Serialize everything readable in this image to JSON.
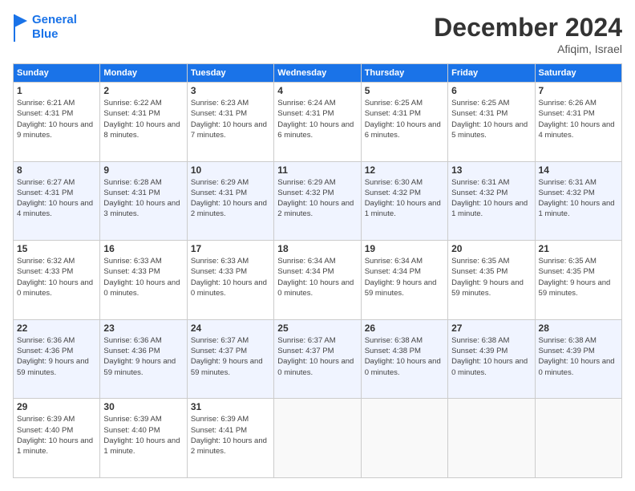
{
  "header": {
    "logo_line1": "General",
    "logo_line2": "Blue",
    "month_title": "December 2024",
    "subtitle": "Afiqim, Israel"
  },
  "days_of_week": [
    "Sunday",
    "Monday",
    "Tuesday",
    "Wednesday",
    "Thursday",
    "Friday",
    "Saturday"
  ],
  "weeks": [
    [
      {
        "day": 1,
        "sunrise": "6:21 AM",
        "sunset": "4:31 PM",
        "daylight": "10 hours and 9 minutes."
      },
      {
        "day": 2,
        "sunrise": "6:22 AM",
        "sunset": "4:31 PM",
        "daylight": "10 hours and 8 minutes."
      },
      {
        "day": 3,
        "sunrise": "6:23 AM",
        "sunset": "4:31 PM",
        "daylight": "10 hours and 7 minutes."
      },
      {
        "day": 4,
        "sunrise": "6:24 AM",
        "sunset": "4:31 PM",
        "daylight": "10 hours and 6 minutes."
      },
      {
        "day": 5,
        "sunrise": "6:25 AM",
        "sunset": "4:31 PM",
        "daylight": "10 hours and 6 minutes."
      },
      {
        "day": 6,
        "sunrise": "6:25 AM",
        "sunset": "4:31 PM",
        "daylight": "10 hours and 5 minutes."
      },
      {
        "day": 7,
        "sunrise": "6:26 AM",
        "sunset": "4:31 PM",
        "daylight": "10 hours and 4 minutes."
      }
    ],
    [
      {
        "day": 8,
        "sunrise": "6:27 AM",
        "sunset": "4:31 PM",
        "daylight": "10 hours and 4 minutes."
      },
      {
        "day": 9,
        "sunrise": "6:28 AM",
        "sunset": "4:31 PM",
        "daylight": "10 hours and 3 minutes."
      },
      {
        "day": 10,
        "sunrise": "6:29 AM",
        "sunset": "4:31 PM",
        "daylight": "10 hours and 2 minutes."
      },
      {
        "day": 11,
        "sunrise": "6:29 AM",
        "sunset": "4:32 PM",
        "daylight": "10 hours and 2 minutes."
      },
      {
        "day": 12,
        "sunrise": "6:30 AM",
        "sunset": "4:32 PM",
        "daylight": "10 hours and 1 minute."
      },
      {
        "day": 13,
        "sunrise": "6:31 AM",
        "sunset": "4:32 PM",
        "daylight": "10 hours and 1 minute."
      },
      {
        "day": 14,
        "sunrise": "6:31 AM",
        "sunset": "4:32 PM",
        "daylight": "10 hours and 1 minute."
      }
    ],
    [
      {
        "day": 15,
        "sunrise": "6:32 AM",
        "sunset": "4:33 PM",
        "daylight": "10 hours and 0 minutes."
      },
      {
        "day": 16,
        "sunrise": "6:33 AM",
        "sunset": "4:33 PM",
        "daylight": "10 hours and 0 minutes."
      },
      {
        "day": 17,
        "sunrise": "6:33 AM",
        "sunset": "4:33 PM",
        "daylight": "10 hours and 0 minutes."
      },
      {
        "day": 18,
        "sunrise": "6:34 AM",
        "sunset": "4:34 PM",
        "daylight": "10 hours and 0 minutes."
      },
      {
        "day": 19,
        "sunrise": "6:34 AM",
        "sunset": "4:34 PM",
        "daylight": "9 hours and 59 minutes."
      },
      {
        "day": 20,
        "sunrise": "6:35 AM",
        "sunset": "4:35 PM",
        "daylight": "9 hours and 59 minutes."
      },
      {
        "day": 21,
        "sunrise": "6:35 AM",
        "sunset": "4:35 PM",
        "daylight": "9 hours and 59 minutes."
      }
    ],
    [
      {
        "day": 22,
        "sunrise": "6:36 AM",
        "sunset": "4:36 PM",
        "daylight": "9 hours and 59 minutes."
      },
      {
        "day": 23,
        "sunrise": "6:36 AM",
        "sunset": "4:36 PM",
        "daylight": "9 hours and 59 minutes."
      },
      {
        "day": 24,
        "sunrise": "6:37 AM",
        "sunset": "4:37 PM",
        "daylight": "9 hours and 59 minutes."
      },
      {
        "day": 25,
        "sunrise": "6:37 AM",
        "sunset": "4:37 PM",
        "daylight": "10 hours and 0 minutes."
      },
      {
        "day": 26,
        "sunrise": "6:38 AM",
        "sunset": "4:38 PM",
        "daylight": "10 hours and 0 minutes."
      },
      {
        "day": 27,
        "sunrise": "6:38 AM",
        "sunset": "4:39 PM",
        "daylight": "10 hours and 0 minutes."
      },
      {
        "day": 28,
        "sunrise": "6:38 AM",
        "sunset": "4:39 PM",
        "daylight": "10 hours and 0 minutes."
      }
    ],
    [
      {
        "day": 29,
        "sunrise": "6:39 AM",
        "sunset": "4:40 PM",
        "daylight": "10 hours and 1 minute."
      },
      {
        "day": 30,
        "sunrise": "6:39 AM",
        "sunset": "4:40 PM",
        "daylight": "10 hours and 1 minute."
      },
      {
        "day": 31,
        "sunrise": "6:39 AM",
        "sunset": "4:41 PM",
        "daylight": "10 hours and 2 minutes."
      },
      null,
      null,
      null,
      null
    ]
  ],
  "labels": {
    "sunrise": "Sunrise:",
    "sunset": "Sunset:",
    "daylight": "Daylight:"
  }
}
